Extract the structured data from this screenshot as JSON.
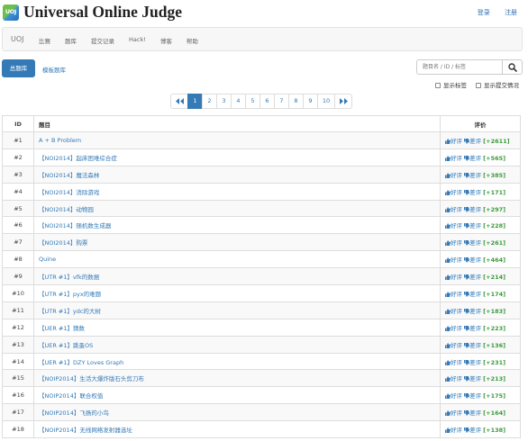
{
  "site": {
    "logo_text": "UOJ",
    "title": "Universal Online Judge"
  },
  "auth": {
    "login": "登录",
    "register": "注册"
  },
  "nav": {
    "brand": "UOJ",
    "items": [
      "比赛",
      "题库",
      "提交记录",
      "Hack!",
      "博客",
      "帮助"
    ]
  },
  "tabs": {
    "active": "总题库",
    "other": "模板题库"
  },
  "search": {
    "placeholder": "题目名 / ID / 标签"
  },
  "options": {
    "show_tags": "显示标签",
    "show_submit": "显示提交情况"
  },
  "pagination": [
    "1",
    "2",
    "3",
    "4",
    "5",
    "6",
    "7",
    "8",
    "9",
    "10"
  ],
  "table": {
    "headers": {
      "id": "ID",
      "title": "题目",
      "eval": "评价"
    },
    "up_label": "好评",
    "down_label": "差评",
    "rows": [
      {
        "id": "#1",
        "title": "A + B Problem",
        "score": "[+2611]"
      },
      {
        "id": "#2",
        "title": "【NOI2014】起床困难综合症",
        "score": "[+565]"
      },
      {
        "id": "#3",
        "title": "【NOI2014】魔法森林",
        "score": "[+385]"
      },
      {
        "id": "#4",
        "title": "【NOI2014】消除游戏",
        "score": "[+171]"
      },
      {
        "id": "#5",
        "title": "【NOI2014】动物园",
        "score": "[+297]"
      },
      {
        "id": "#6",
        "title": "【NOI2014】随机数生成器",
        "score": "[+228]"
      },
      {
        "id": "#7",
        "title": "【NOI2014】购票",
        "score": "[+261]"
      },
      {
        "id": "#8",
        "title": "Quine",
        "score": "[+464]"
      },
      {
        "id": "#9",
        "title": "【UTR #1】vfk的数据",
        "score": "[+214]"
      },
      {
        "id": "#10",
        "title": "【UTR #1】pyx的难题",
        "score": "[+174]"
      },
      {
        "id": "#11",
        "title": "【UTR #1】ydc的大树",
        "score": "[+183]"
      },
      {
        "id": "#12",
        "title": "【UER #1】猜数",
        "score": "[+223]"
      },
      {
        "id": "#13",
        "title": "【UER #1】跳蚤OS",
        "score": "[+136]"
      },
      {
        "id": "#14",
        "title": "【UER #1】DZY Loves Graph",
        "score": "[+231]"
      },
      {
        "id": "#15",
        "title": "【NOIP2014】生活大爆炸版石头剪刀布",
        "score": "[+213]"
      },
      {
        "id": "#16",
        "title": "【NOIP2014】联合权值",
        "score": "[+175]"
      },
      {
        "id": "#17",
        "title": "【NOIP2014】飞扬的小鸟",
        "score": "[+164]"
      },
      {
        "id": "#18",
        "title": "【NOIP2014】无线网络发射器选址",
        "score": "[+138]"
      }
    ]
  },
  "colors": {
    "accent": "#337ab7",
    "score": "#3c9b3c"
  },
  "icons": {
    "up": "thumbs-up-icon",
    "down": "thumbs-down-icon",
    "search": "search-icon",
    "first": "double-chevron-left-icon",
    "last": "double-chevron-right-icon"
  }
}
